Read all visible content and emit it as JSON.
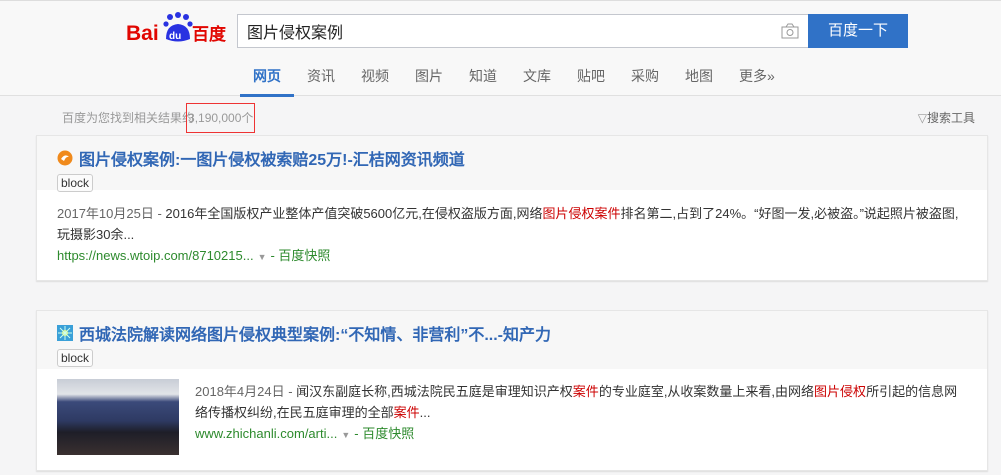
{
  "header": {
    "logo_text": "Bai du 百度",
    "search_value": "图片侵权案例",
    "search_button": "百度一下",
    "camera_icon": "camera-icon",
    "tabs": [
      "网页",
      "资讯",
      "视频",
      "图片",
      "知道",
      "文库",
      "贴吧",
      "采购",
      "地图",
      "更多»"
    ]
  },
  "stats": {
    "prefix": "百度为您找到相关结果约",
    "count": "3,190,000",
    "suffix": "个"
  },
  "tools": {
    "icon": "filter-icon",
    "label": "搜索工具"
  },
  "colors": {
    "accent": "#3072c7",
    "link": "#3167b5",
    "highlight": "#cc0000",
    "url": "#2d8a2d"
  },
  "results": [
    {
      "title": "图片侵权案例:一图片侵权被索赔25万!-汇桔网资讯频道",
      "tag": "block",
      "date": "2017年10月25日 - ",
      "snippet": [
        {
          "t": "2016年全国版权产业整体产值突破5600亿元,在侵权盗版方面,网络"
        },
        {
          "t": "图片侵权案件",
          "hl": true
        },
        {
          "t": "排名第二,占到了24%。“好图一发,必被盗。”说起照片被盗图,玩摄影30余..."
        }
      ],
      "url": "https://news.wtoip.com/8710215...",
      "snapshot": "- 百度快照"
    },
    {
      "title": "西城法院解读网络图片侵权典型案例:“不知情、非营利”不...-知产力",
      "tag": "block",
      "date": "2018年4月24日 - ",
      "snippet": [
        {
          "t": "闻汉东副庭长称,西城法院民五庭是审理知识产权"
        },
        {
          "t": "案件",
          "hl": true
        },
        {
          "t": "的专业庭室,从收案数量上来看,由网络"
        },
        {
          "t": "图片侵权",
          "hl": true
        },
        {
          "t": "所引起的信息网络传播权纠纷,在民五庭审理的全部"
        },
        {
          "t": "案件",
          "hl": true
        },
        {
          "t": "..."
        }
      ],
      "url": "www.zhichanli.com/arti...",
      "snapshot": "- 百度快照"
    }
  ]
}
